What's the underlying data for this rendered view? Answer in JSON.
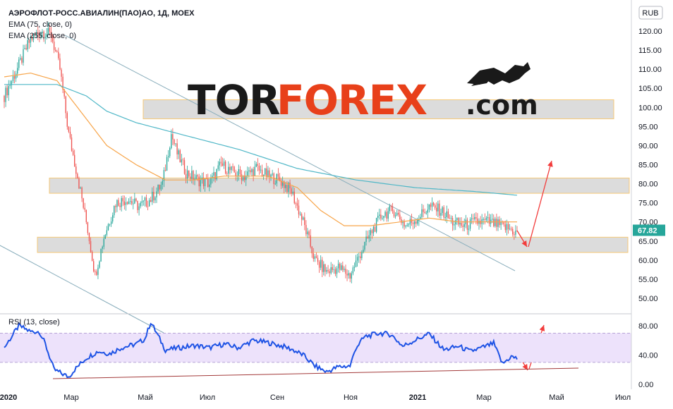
{
  "header": {
    "symbol": "АЭРОФЛОТ-РОСС.АВИАЛИН(ПАО)АО, 1Д, MOEX",
    "ema1": "EMA (75, close, 0)",
    "ema2": "EMA (255, close, 0)",
    "currency": "RUB"
  },
  "watermark": {
    "part1": "TOR",
    "part2": "FOREX",
    "part3": ".com",
    "logo_icon": "bull-icon"
  },
  "colors": {
    "up": "#26a69a",
    "down": "#ef5350",
    "ema75": "#f7a54a",
    "ema255": "#4fb7c7",
    "rsi": "#1e53e5",
    "rsi_band": "#ede2fb",
    "trend": "#8aaebc",
    "arrow": "#f23c3c",
    "zone_fill": "#d9d9d9",
    "zone_border": "#f6c46a",
    "price_tag": "#26a69a"
  },
  "price_scale": {
    "ticks": [
      "120.00",
      "115.00",
      "110.00",
      "105.00",
      "100.00",
      "95.00",
      "90.00",
      "85.00",
      "80.00",
      "75.00",
      "70.00",
      "65.00",
      "60.00",
      "55.00",
      "50.00"
    ],
    "last_price": "67.82"
  },
  "rsi_scale": {
    "title": "RSI (13, close)",
    "ticks": [
      "80.00",
      "40.00",
      "0.00"
    ]
  },
  "time_axis": [
    "2020",
    "Мар",
    "Май",
    "Июл",
    "Сен",
    "Ноя",
    "2021",
    "Мар",
    "Май",
    "Июл"
  ],
  "chart_data": {
    "type": "candlestick",
    "price_range": [
      48,
      122
    ],
    "price_anchors": [
      [
        0,
        103
      ],
      [
        10,
        111
      ],
      [
        18,
        118
      ],
      [
        25,
        120
      ],
      [
        32,
        119
      ],
      [
        38,
        110
      ],
      [
        44,
        93
      ],
      [
        50,
        82
      ],
      [
        57,
        68
      ],
      [
        62,
        56
      ],
      [
        68,
        66
      ],
      [
        76,
        75
      ],
      [
        84,
        76
      ],
      [
        92,
        74
      ],
      [
        100,
        76
      ],
      [
        108,
        80
      ],
      [
        114,
        93
      ],
      [
        118,
        88
      ],
      [
        124,
        83
      ],
      [
        132,
        81
      ],
      [
        140,
        80
      ],
      [
        148,
        85
      ],
      [
        156,
        83
      ],
      [
        164,
        82
      ],
      [
        172,
        84
      ],
      [
        180,
        82
      ],
      [
        188,
        81
      ],
      [
        196,
        78
      ],
      [
        204,
        70
      ],
      [
        212,
        60
      ],
      [
        220,
        57
      ],
      [
        228,
        58
      ],
      [
        236,
        56
      ],
      [
        242,
        61
      ],
      [
        250,
        67
      ],
      [
        258,
        72
      ],
      [
        266,
        73
      ],
      [
        274,
        69
      ],
      [
        282,
        71
      ],
      [
        290,
        74
      ],
      [
        298,
        73
      ],
      [
        306,
        70
      ],
      [
        314,
        69
      ],
      [
        322,
        70
      ],
      [
        330,
        70
      ],
      [
        338,
        69
      ],
      [
        346,
        68
      ],
      [
        350,
        67
      ]
    ],
    "ema75_anchors": [
      [
        0,
        108
      ],
      [
        18,
        109
      ],
      [
        36,
        107
      ],
      [
        56,
        97
      ],
      [
        70,
        90
      ],
      [
        90,
        85
      ],
      [
        110,
        81
      ],
      [
        130,
        81
      ],
      [
        150,
        82
      ],
      [
        180,
        82
      ],
      [
        200,
        79
      ],
      [
        216,
        73
      ],
      [
        232,
        69
      ],
      [
        250,
        69
      ],
      [
        270,
        70
      ],
      [
        290,
        71
      ],
      [
        310,
        70
      ],
      [
        340,
        70
      ],
      [
        350,
        70
      ]
    ],
    "ema255_anchors": [
      [
        0,
        106
      ],
      [
        36,
        106
      ],
      [
        56,
        103
      ],
      [
        70,
        99
      ],
      [
        90,
        96
      ],
      [
        120,
        93
      ],
      [
        160,
        89
      ],
      [
        200,
        84
      ],
      [
        240,
        81
      ],
      [
        280,
        79
      ],
      [
        320,
        78
      ],
      [
        350,
        77
      ]
    ],
    "rsi_anchors": [
      [
        0,
        50
      ],
      [
        10,
        80
      ],
      [
        18,
        72
      ],
      [
        24,
        72
      ],
      [
        28,
        55
      ],
      [
        34,
        20
      ],
      [
        40,
        14
      ],
      [
        44,
        10
      ],
      [
        48,
        20
      ],
      [
        56,
        36
      ],
      [
        64,
        45
      ],
      [
        72,
        42
      ],
      [
        80,
        50
      ],
      [
        90,
        55
      ],
      [
        96,
        62
      ],
      [
        100,
        85
      ],
      [
        104,
        70
      ],
      [
        110,
        47
      ],
      [
        120,
        50
      ],
      [
        130,
        53
      ],
      [
        140,
        50
      ],
      [
        150,
        55
      ],
      [
        160,
        50
      ],
      [
        170,
        60
      ],
      [
        180,
        57
      ],
      [
        190,
        52
      ],
      [
        196,
        48
      ],
      [
        204,
        40
      ],
      [
        212,
        25
      ],
      [
        220,
        17
      ],
      [
        228,
        24
      ],
      [
        236,
        25
      ],
      [
        240,
        50
      ],
      [
        246,
        65
      ],
      [
        256,
        70
      ],
      [
        264,
        68
      ],
      [
        272,
        52
      ],
      [
        280,
        60
      ],
      [
        290,
        69
      ],
      [
        300,
        47
      ],
      [
        310,
        52
      ],
      [
        318,
        45
      ],
      [
        326,
        50
      ],
      [
        334,
        56
      ],
      [
        340,
        28
      ],
      [
        346,
        38
      ],
      [
        350,
        35
      ]
    ],
    "levels": [
      {
        "name": "zone-100",
        "range": [
          97,
          102
        ]
      },
      {
        "name": "zone-80",
        "range": [
          77.5,
          81.5
        ]
      },
      {
        "name": "zone-64",
        "range": [
          62,
          66
        ]
      }
    ],
    "rsi_band": [
      30,
      70
    ]
  }
}
